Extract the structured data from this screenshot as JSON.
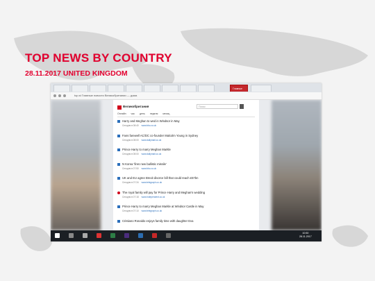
{
  "slide": {
    "title": "TOP NEWS BY COUNTRY",
    "subtitle": "28.11.2017 UNITED KINGDOM"
  },
  "browser": {
    "tabs": [
      "",
      "",
      "",
      "",
      "",
      "",
      "",
      "",
      "",
      "Главные",
      ""
    ],
    "active_tab_index": 9,
    "address": "top.st Главные новости Великобритании — дома"
  },
  "news_page": {
    "logo": "Великобритания",
    "search_placeholder": "Поиск",
    "filters": [
      "Онлайн",
      "час",
      "день",
      "неделя",
      "месяц"
    ],
    "items": [
      {
        "title": "Harry and Meghan to wed in Windsor in May",
        "meta": "Сегодня в 08:40",
        "source": "www.bbc.co.uk",
        "icon": "news-icon"
      },
      {
        "title": "Fans farewell AC/DC co-founder Malcolm Young in Sydney",
        "meta": "Сегодня в 08:00",
        "source": "www.dailymail.co.uk",
        "icon": "news-icon"
      },
      {
        "title": "Prince Harry to marry Meghan Markle",
        "meta": "Сегодня в 08:00",
        "source": "www.dailymail.co.uk",
        "icon": "news-icon"
      },
      {
        "title": "N Korea 'fires new ballistic missile'",
        "meta": "Сегодня в 07:50",
        "source": "www.bbc.co.uk",
        "icon": "news-icon"
      },
      {
        "title": "UK and EU agree Brexit divorce bill that could reach £57bn",
        "meta": "Сегодня в 07:34",
        "source": "www.telegraph.co.uk",
        "icon": "news-icon"
      },
      {
        "title": "The royal family will pay for Prince Harry and Meghan's wedding",
        "meta": "Сегодня в 07:18",
        "source": "www.independent.co.uk",
        "icon": "red-news-icon"
      },
      {
        "title": "Prince Harry to marry Meghan Markle at Windsor Castle in May",
        "meta": "Сегодня в 07:10",
        "source": "www.telegraph.co.uk",
        "icon": "news-icon"
      },
      {
        "title": "Cristiano Ronaldo enjoys family time with daughter Eva",
        "meta": "",
        "source": "",
        "icon": "news-icon"
      }
    ]
  },
  "taskbar": {
    "time": "10:50",
    "date": "28.11.2017"
  },
  "colors": {
    "accent": "#e3002f",
    "taskbar": "#1b1f24"
  }
}
